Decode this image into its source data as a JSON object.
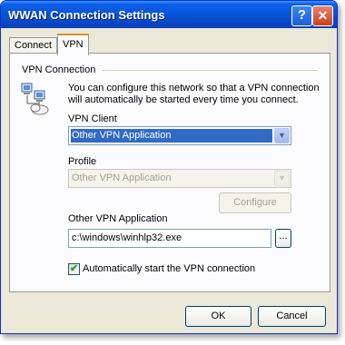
{
  "window": {
    "title": "WWAN Connection Settings"
  },
  "titlebar": {
    "help_label": "?",
    "close_label": "✕"
  },
  "tabs": [
    {
      "label": "Connect"
    },
    {
      "label": "VPN"
    }
  ],
  "vpn_connection": {
    "group_label": "VPN Connection",
    "description_line1": "You can configure this network so that a VPN connection",
    "description_line2": "will automatically be started every time you connect.",
    "vpn_client_label": "VPN Client",
    "vpn_client_value": "Other VPN Application",
    "profile_label": "Profile",
    "profile_value": "Other VPN Application",
    "configure_button": "Configure",
    "other_app_label": "Other VPN Application",
    "other_app_value": "c:\\windows\\winhlp32.exe",
    "browse_button": "...",
    "auto_start_label": "Automatically start the VPN connection",
    "auto_start_checked": true
  },
  "footer": {
    "ok_button": "OK",
    "cancel_button": "Cancel"
  },
  "colors": {
    "titlebar": "#0855dd",
    "selection": "#316ac5",
    "dialog_bg": "#ece9d8"
  }
}
